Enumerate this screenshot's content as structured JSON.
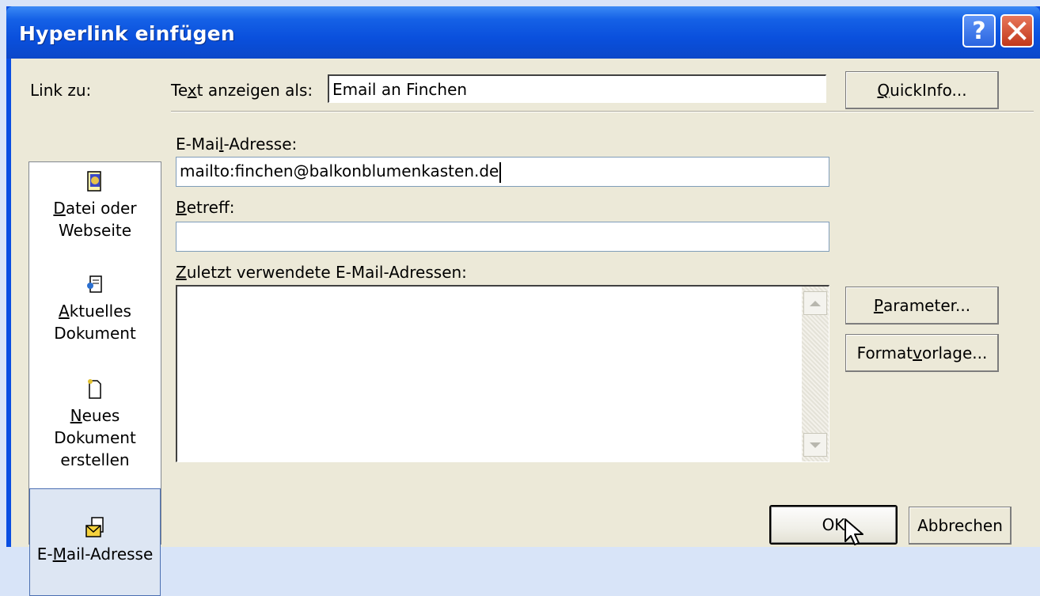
{
  "window": {
    "title": "Hyperlink einfügen",
    "help_icon": "help-icon",
    "close_icon": "close-icon"
  },
  "link_to": {
    "label": "Link zu:",
    "items": [
      {
        "icon": "file-webpage-icon",
        "label_underlined": "D",
        "label_rest": "atei oder",
        "line2": "Webseite"
      },
      {
        "icon": "current-document-icon",
        "label_underlined": "A",
        "label_rest": "ktuelles",
        "line2": "Dokument"
      },
      {
        "icon": "new-document-icon",
        "label_underlined": "N",
        "label_rest": "eues",
        "line2": "Dokument",
        "line3": "erstellen"
      },
      {
        "icon": "email-address-icon",
        "label_pre": "E-",
        "label_underlined": "M",
        "label_rest": "ail-Adresse",
        "selected": true
      }
    ]
  },
  "display_text": {
    "label_pre": "Te",
    "label_underlined": "x",
    "label_rest": "t anzeigen als:",
    "value": "Email an Finchen"
  },
  "quickinfo_button": {
    "pre": "",
    "underlined": "Q",
    "rest": "uickInfo..."
  },
  "email": {
    "label_pre": "E-Mai",
    "label_underlined": "l",
    "label_rest": "-Adresse:",
    "value": "mailto:finchen@balkonblumenkasten.de"
  },
  "subject": {
    "label_underlined": "B",
    "label_rest": "etreff:",
    "value": ""
  },
  "recent": {
    "label_underlined": "Z",
    "label_rest": "uletzt verwendete E-Mail-Adressen:",
    "items": []
  },
  "parameter_button": {
    "underlined": "P",
    "rest": "arameter..."
  },
  "style_button": {
    "pre": "Format",
    "underlined": "v",
    "rest": "orlage..."
  },
  "ok_button": "OK",
  "cancel_button": "Abbrechen"
}
